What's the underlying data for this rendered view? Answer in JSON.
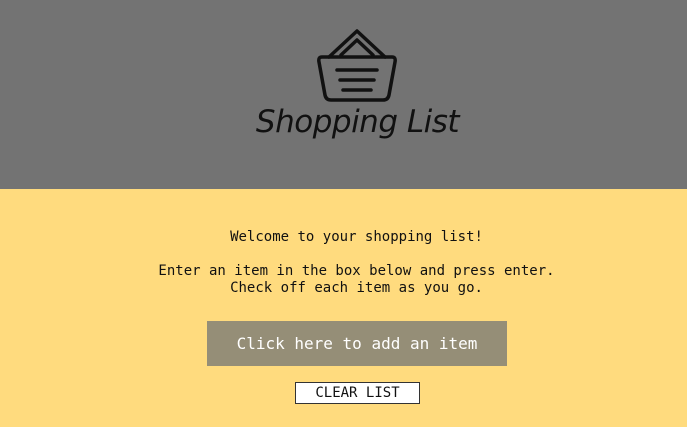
{
  "header": {
    "title": "Shopping List",
    "icon": "basket-icon"
  },
  "intro": {
    "welcome": "Welcome to your shopping list!",
    "instruction_line1": "Enter an item in the box below and press enter.",
    "instruction_line2": "Check off each item as you go."
  },
  "actions": {
    "add_label": "Click here to add an item",
    "clear_label": "CLEAR LIST"
  },
  "colors": {
    "header_bg": "#737373",
    "main_bg": "#FFDB7E",
    "add_button_bg": "#958E77"
  }
}
